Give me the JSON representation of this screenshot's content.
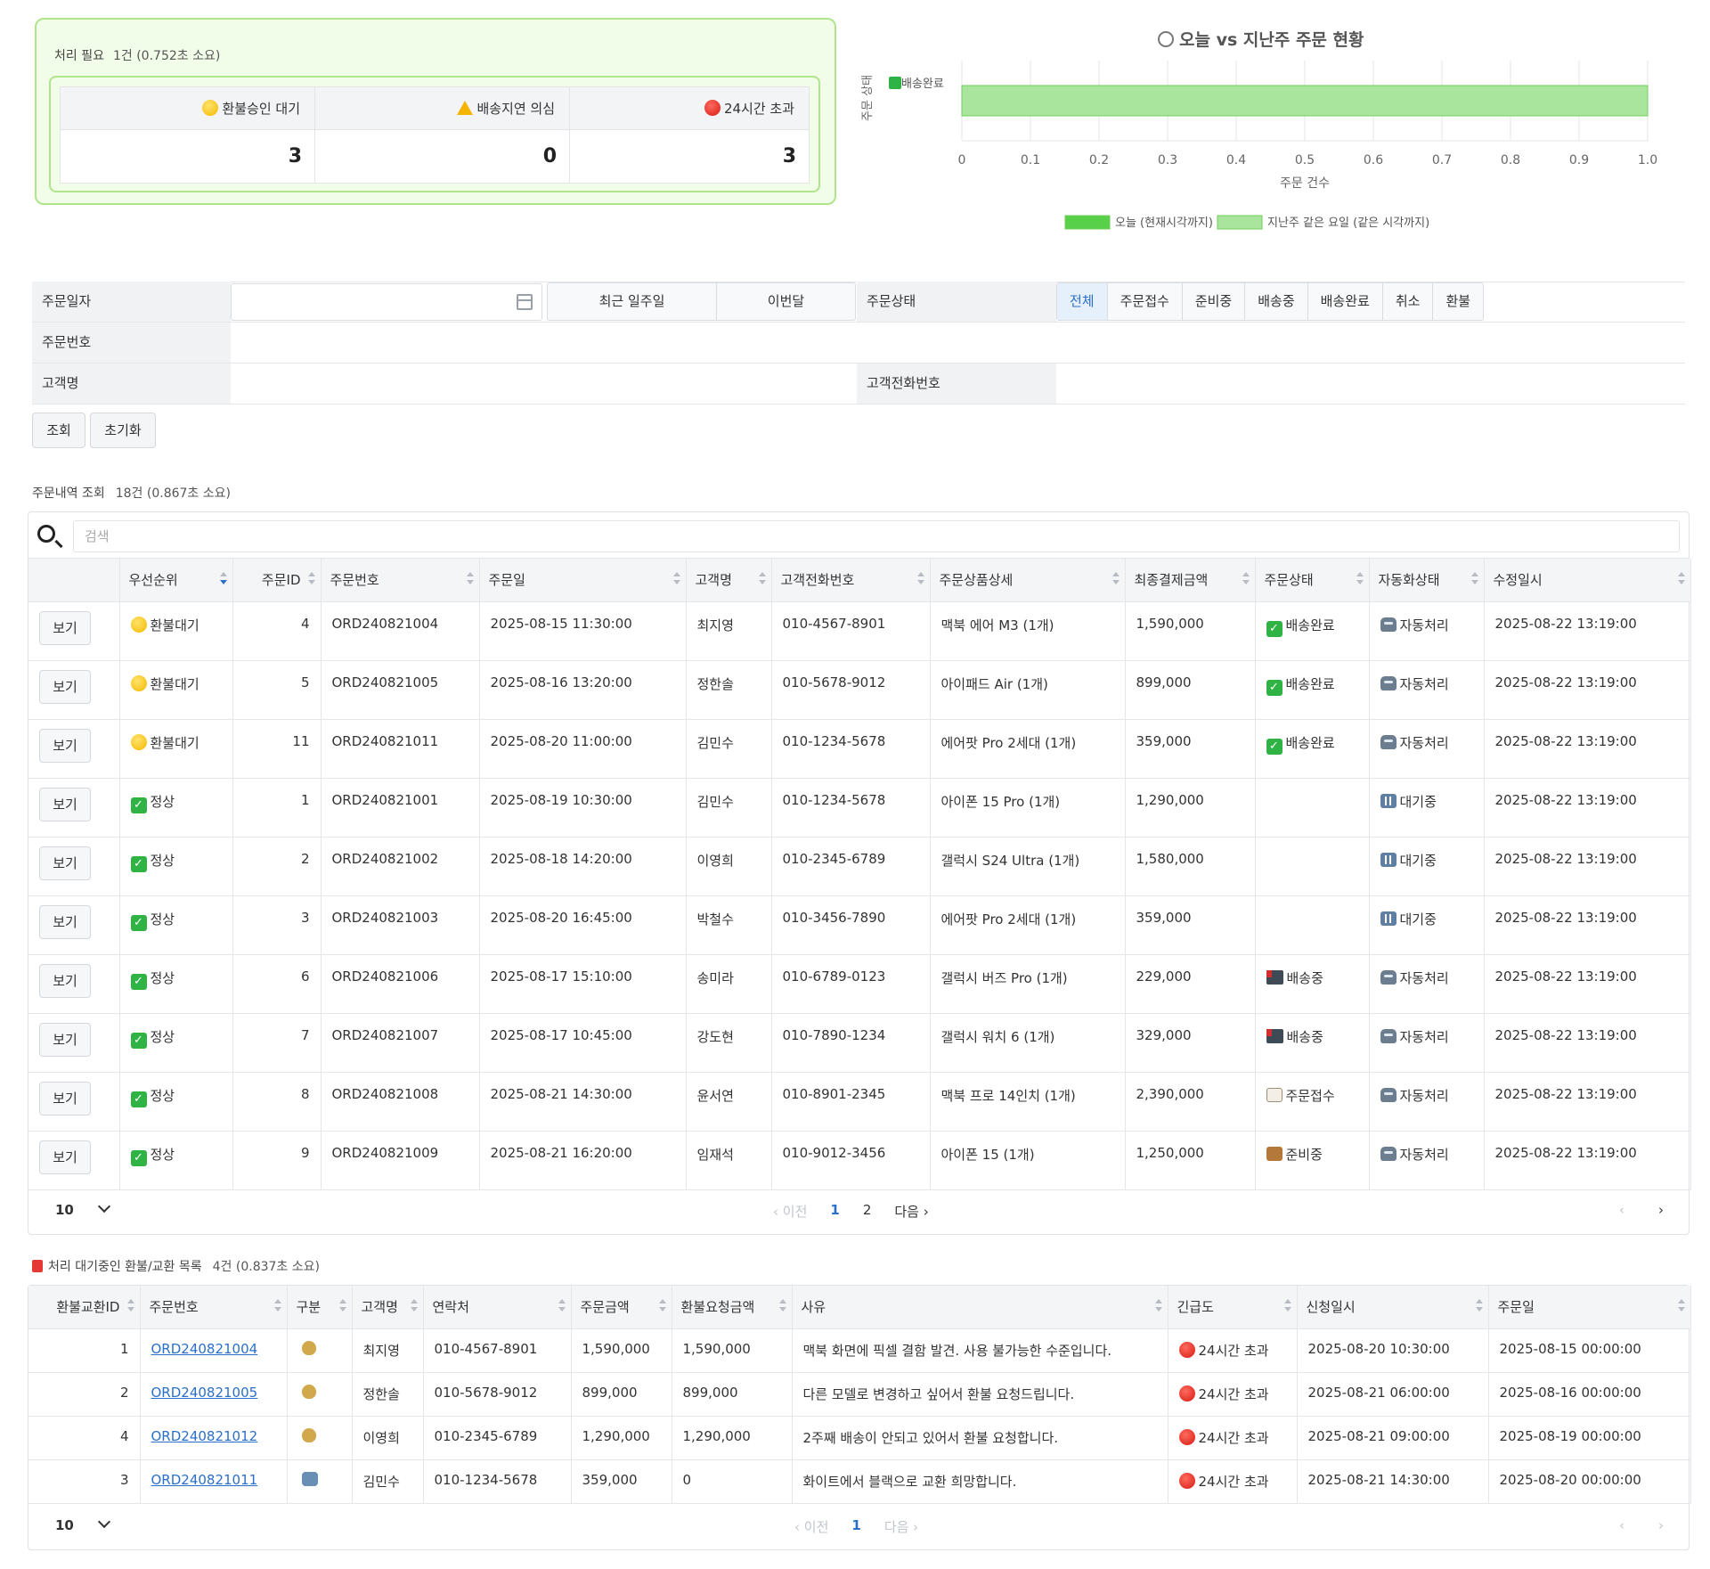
{
  "alert": {
    "heading": "처리 필요",
    "meta": "1건 (0.752초 소요)",
    "cols": [
      {
        "label": "환불승인 대기",
        "value": "3",
        "icon": "yellow-circle-icon"
      },
      {
        "label": "배송지연 의심",
        "value": "0",
        "icon": "warning-icon"
      },
      {
        "label": "24시간 초과",
        "value": "3",
        "icon": "red-circle-icon"
      }
    ]
  },
  "chart_title": "오늘 vs 지난주 주문 현황",
  "chart_data": {
    "type": "bar",
    "orientation": "horizontal",
    "title": "오늘 vs 지난주 주문 현황",
    "categories": [
      "✅ 배송완료"
    ],
    "series": [
      {
        "name": "오늘 (현재시각까지)",
        "values": [
          0
        ],
        "color": "#59d04a"
      },
      {
        "name": "지난주 같은 요일 (같은 시각까지)",
        "values": [
          1
        ],
        "color": "#a9e59c"
      }
    ],
    "xlabel": "주문 건수",
    "ylabel": "주문 상태",
    "xlim": [
      0,
      1.0
    ],
    "xticks": [
      "0",
      "0.1",
      "0.2",
      "0.3",
      "0.4",
      "0.5",
      "0.6",
      "0.7",
      "0.8",
      "0.9",
      "1.0"
    ],
    "grid": true,
    "legend": "bottom"
  },
  "filter": {
    "order_date_label": "주문일자",
    "quick": [
      "최근 일주일",
      "이번달"
    ],
    "status_label": "주문상태",
    "status_options": [
      "전체",
      "주문접수",
      "준비중",
      "배송중",
      "배송완료",
      "취소",
      "환불"
    ],
    "status_selected": "전체",
    "order_no_label": "주문번호",
    "customer_label": "고객명",
    "phone_label": "고객전화번호",
    "search_btn": "조회",
    "reset_btn": "초기화"
  },
  "orders": {
    "heading": "주문내역 조회",
    "meta": "18건 (0.867초 소요)",
    "search_placeholder": "검색",
    "columns": [
      "",
      "우선순위",
      "주문ID",
      "주문번호",
      "주문일",
      "고객명",
      "고객전화번호",
      "주문상품상세",
      "최종결제금액",
      "주문상태",
      "자동화상태",
      "수정일시"
    ],
    "view_label": "보기",
    "rows": [
      {
        "priority": "환불대기",
        "pri_icon": "yellow-circle-icon",
        "id": "4",
        "no": "ORD240821004",
        "date": "2025-08-15 11:30:00",
        "name": "최지영",
        "phone": "010-4567-8901",
        "product": "맥북 에어 M3 (1개)",
        "amount": "1,590,000",
        "status": "배송완료",
        "status_icon": "check-icon",
        "auto": "자동처리",
        "auto_icon": "robot-icon",
        "updated": "2025-08-22 13:19:00"
      },
      {
        "priority": "환불대기",
        "pri_icon": "yellow-circle-icon",
        "id": "5",
        "no": "ORD240821005",
        "date": "2025-08-16 13:20:00",
        "name": "정한솔",
        "phone": "010-5678-9012",
        "product": "아이패드 Air (1개)",
        "amount": "899,000",
        "status": "배송완료",
        "status_icon": "check-icon",
        "auto": "자동처리",
        "auto_icon": "robot-icon",
        "updated": "2025-08-22 13:19:00"
      },
      {
        "priority": "환불대기",
        "pri_icon": "yellow-circle-icon",
        "id": "11",
        "no": "ORD240821011",
        "date": "2025-08-20 11:00:00",
        "name": "김민수",
        "phone": "010-1234-5678",
        "product": "에어팟 Pro 2세대 (1개)",
        "amount": "359,000",
        "status": "배송완료",
        "status_icon": "check-icon",
        "auto": "자동처리",
        "auto_icon": "robot-icon",
        "updated": "2025-08-22 13:19:00"
      },
      {
        "priority": "정상",
        "pri_icon": "check-icon",
        "id": "1",
        "no": "ORD240821001",
        "date": "2025-08-19 10:30:00",
        "name": "김민수",
        "phone": "010-1234-5678",
        "product": "아이폰 15 Pro (1개)",
        "amount": "1,290,000",
        "status": "",
        "status_icon": "",
        "auto": "대기중",
        "auto_icon": "pause-icon",
        "updated": "2025-08-22 13:19:00"
      },
      {
        "priority": "정상",
        "pri_icon": "check-icon",
        "id": "2",
        "no": "ORD240821002",
        "date": "2025-08-18 14:20:00",
        "name": "이영희",
        "phone": "010-2345-6789",
        "product": "갤럭시 S24 Ultra (1개)",
        "amount": "1,580,000",
        "status": "",
        "status_icon": "",
        "auto": "대기중",
        "auto_icon": "pause-icon",
        "updated": "2025-08-22 13:19:00"
      },
      {
        "priority": "정상",
        "pri_icon": "check-icon",
        "id": "3",
        "no": "ORD240821003",
        "date": "2025-08-20 16:45:00",
        "name": "박철수",
        "phone": "010-3456-7890",
        "product": "에어팟 Pro 2세대 (1개)",
        "amount": "359,000",
        "status": "",
        "status_icon": "",
        "auto": "대기중",
        "auto_icon": "pause-icon",
        "updated": "2025-08-22 13:19:00"
      },
      {
        "priority": "정상",
        "pri_icon": "check-icon",
        "id": "6",
        "no": "ORD240821006",
        "date": "2025-08-17 15:10:00",
        "name": "송미라",
        "phone": "010-6789-0123",
        "product": "갤럭시 버즈 Pro (1개)",
        "amount": "229,000",
        "status": "배송중",
        "status_icon": "truck-icon",
        "auto": "자동처리",
        "auto_icon": "robot-icon",
        "updated": "2025-08-22 13:19:00"
      },
      {
        "priority": "정상",
        "pri_icon": "check-icon",
        "id": "7",
        "no": "ORD240821007",
        "date": "2025-08-17 10:45:00",
        "name": "강도현",
        "phone": "010-7890-1234",
        "product": "갤럭시 워치 6 (1개)",
        "amount": "329,000",
        "status": "배송중",
        "status_icon": "truck-icon",
        "auto": "자동처리",
        "auto_icon": "robot-icon",
        "updated": "2025-08-22 13:19:00"
      },
      {
        "priority": "정상",
        "pri_icon": "check-icon",
        "id": "8",
        "no": "ORD240821008",
        "date": "2025-08-21 14:30:00",
        "name": "윤서연",
        "phone": "010-8901-2345",
        "product": "맥북 프로 14인치 (1개)",
        "amount": "2,390,000",
        "status": "주문접수",
        "status_icon": "memo-icon",
        "auto": "자동처리",
        "auto_icon": "robot-icon",
        "updated": "2025-08-22 13:19:00"
      },
      {
        "priority": "정상",
        "pri_icon": "check-icon",
        "id": "9",
        "no": "ORD240821009",
        "date": "2025-08-21 16:20:00",
        "name": "임재석",
        "phone": "010-9012-3456",
        "product": "아이폰 15 (1개)",
        "amount": "1,250,000",
        "status": "준비중",
        "status_icon": "box-icon",
        "auto": "자동처리",
        "auto_icon": "robot-icon",
        "updated": "2025-08-22 13:19:00"
      }
    ],
    "pager": {
      "size": "10",
      "prev": "‹ 이전",
      "pages": [
        "1",
        "2"
      ],
      "current": "1",
      "next": "다음 ›",
      "first": "‹",
      "last": "›"
    }
  },
  "refunds": {
    "heading": "처리 대기중인 환불/교환 목록",
    "meta": "4건 (0.837초 소요)",
    "columns": [
      "환불교환ID",
      "주문번호",
      "구분",
      "고객명",
      "연락처",
      "주문금액",
      "환불요청금액",
      "사유",
      "긴급도",
      "신청일시",
      "주문일"
    ],
    "rows": [
      {
        "id": "1",
        "no": "ORD240821004",
        "type_icon": "money-bag-icon",
        "name": "최지영",
        "phone": "010-4567-8901",
        "amount": "1,590,000",
        "refund": "1,590,000",
        "reason": "맥북 화면에 픽셀 결함 발견. 사용 불가능한 수준입니다.",
        "urgency": "24시간 초과",
        "requested": "2025-08-20 10:30:00",
        "ordered": "2025-08-15 00:00:00"
      },
      {
        "id": "2",
        "no": "ORD240821005",
        "type_icon": "money-bag-icon",
        "name": "정한솔",
        "phone": "010-5678-9012",
        "amount": "899,000",
        "refund": "899,000",
        "reason": "다른 모델로 변경하고 싶어서 환불 요청드립니다.",
        "urgency": "24시간 초과",
        "requested": "2025-08-21 06:00:00",
        "ordered": "2025-08-16 00:00:00"
      },
      {
        "id": "4",
        "no": "ORD240821012",
        "type_icon": "money-bag-icon",
        "name": "이영희",
        "phone": "010-2345-6789",
        "amount": "1,290,000",
        "refund": "1,290,000",
        "reason": "2주째 배송이 안되고 있어서 환불 요청합니다.",
        "urgency": "24시간 초과",
        "requested": "2025-08-21 09:00:00",
        "ordered": "2025-08-19 00:00:00"
      },
      {
        "id": "3",
        "no": "ORD240821011",
        "type_icon": "exchange-icon",
        "name": "김민수",
        "phone": "010-1234-5678",
        "amount": "359,000",
        "refund": "0",
        "reason": "화이트에서 블랙으로 교환 희망합니다.",
        "urgency": "24시간 초과",
        "requested": "2025-08-21 14:30:00",
        "ordered": "2025-08-20 00:00:00"
      }
    ],
    "pager": {
      "size": "10",
      "prev": "‹ 이전",
      "pages": [
        "1"
      ],
      "current": "1",
      "next": "다음 ›",
      "first": "‹",
      "last": "›"
    }
  }
}
